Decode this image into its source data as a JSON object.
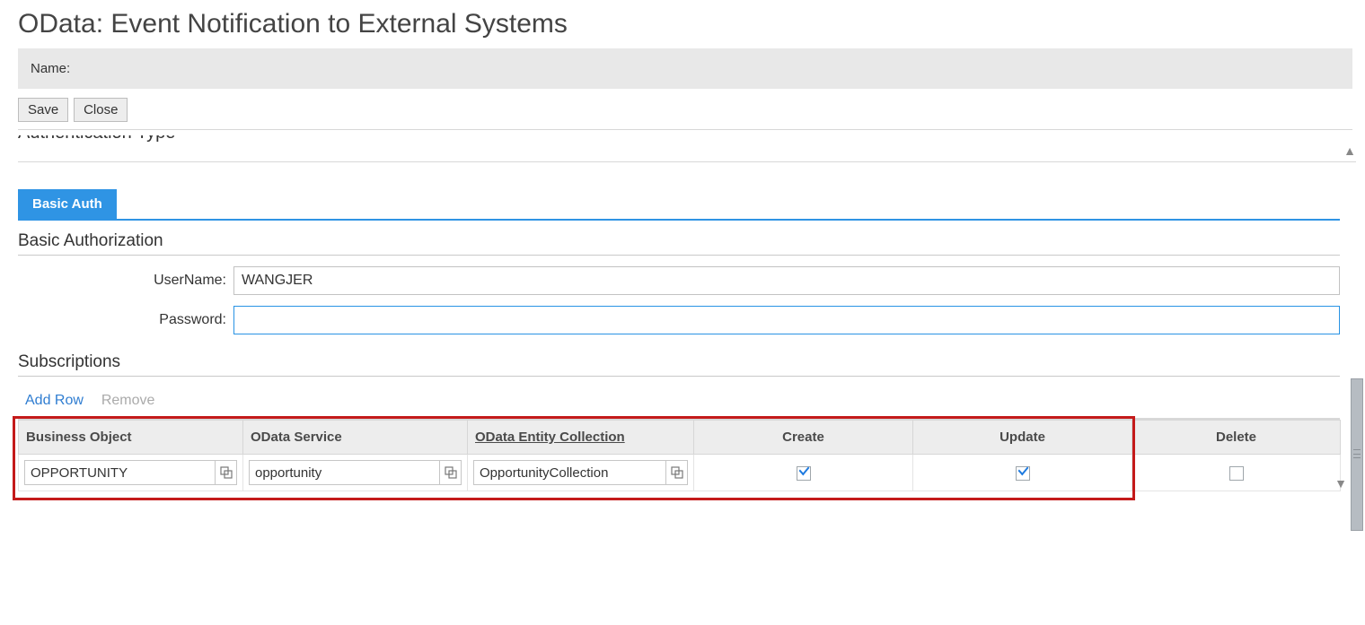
{
  "page_title": "OData: Event Notification to External Systems",
  "name_bar_label": "Name:",
  "toolbar": {
    "save_label": "Save",
    "close_label": "Close"
  },
  "clipped_section_heading": "Authentication Type",
  "tabs": {
    "basic_auth_label": "Basic Auth"
  },
  "basic_auth": {
    "section_heading": "Basic Authorization",
    "username_label": "UserName:",
    "username_value": "WANGJER",
    "password_label": "Password:",
    "password_value": ""
  },
  "subscriptions": {
    "section_heading": "Subscriptions",
    "add_row_label": "Add Row",
    "remove_label": "Remove",
    "columns": {
      "business_object": "Business Object",
      "odata_service": "OData Service",
      "odata_entity_collection": "OData Entity Collection",
      "create": "Create",
      "update": "Update",
      "delete": "Delete"
    },
    "rows": [
      {
        "business_object": "OPPORTUNITY",
        "odata_service": "opportunity",
        "odata_entity_collection": "OpportunityCollection",
        "create": true,
        "update": true,
        "delete": false
      }
    ]
  }
}
